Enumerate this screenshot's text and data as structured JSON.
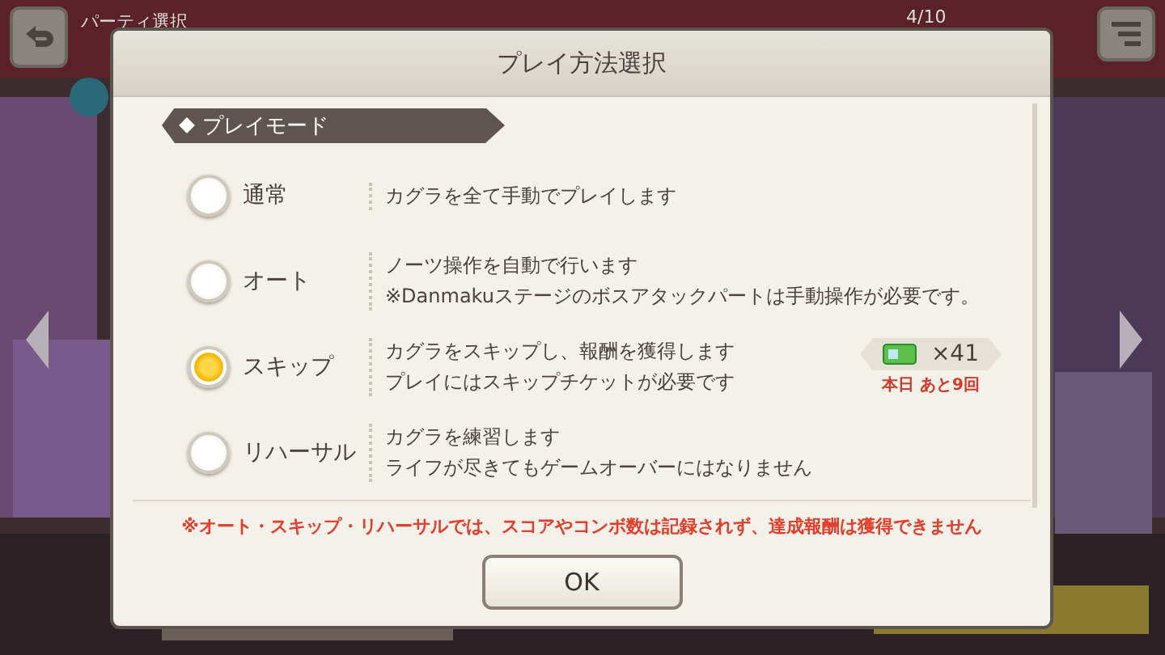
{
  "background": {
    "screen_title": "パーティ選択",
    "stamina": "4/10"
  },
  "dialog": {
    "title": "プレイ方法選択",
    "section": "プレイモード",
    "modes": [
      {
        "label": "通常",
        "selected": false,
        "description": [
          "カグラを全て手動でプレイします"
        ]
      },
      {
        "label": "オート",
        "selected": false,
        "description": [
          "ノーツ操作を自動で行います",
          "※Danmakuステージのボスアタックパートは手動操作が必要です。"
        ]
      },
      {
        "label": "スキップ",
        "selected": true,
        "description": [
          "カグラをスキップし、報酬を獲得します",
          "プレイにはスキップチケットが必要です"
        ],
        "ticket": {
          "count": "×41",
          "remaining": "本日 あと9回"
        }
      },
      {
        "label": "リハーサル",
        "selected": false,
        "description": [
          "カグラを練習します",
          "ライフが尽きてもゲームオーバーにはなりません"
        ]
      }
    ],
    "note": "※オート・スキップ・リハーサルでは、スコアやコンボ数は記録されず、達成報酬は獲得できません",
    "buttons": [
      "OK"
    ]
  }
}
